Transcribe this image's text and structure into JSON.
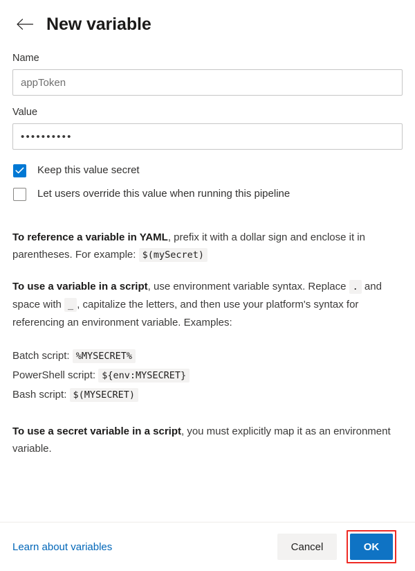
{
  "header": {
    "back_icon": "arrow-left-icon",
    "title": "New variable"
  },
  "form": {
    "name_label": "Name",
    "name_value": "appToken",
    "name_placeholder": "appToken",
    "value_label": "Value",
    "value_masked": "••••••••••",
    "value_placeholder": "",
    "checkboxes": [
      {
        "label": "Keep this value secret",
        "checked": true
      },
      {
        "label": "Let users override this value when running this pipeline",
        "checked": false
      }
    ]
  },
  "help": {
    "para1": {
      "bold": "To reference a variable in YAML",
      "text_before_code": ", prefix it with a dollar sign and enclose it in parentheses. For example: ",
      "code": "$(mySecret)"
    },
    "para2": {
      "bold": "To use a variable in a script",
      "text1": ", use environment variable syntax. Replace ",
      "code1": ".",
      "text2": " and space with ",
      "code2": "_",
      "text3": ", capitalize the letters, and then use your platform's syntax for referencing an environment variable. Examples:"
    },
    "examples": [
      {
        "label": "Batch script:",
        "code": "%MYSECRET%"
      },
      {
        "label": "PowerShell script:",
        "code": "${env:MYSECRET}"
      },
      {
        "label": "Bash script:",
        "code": "$(MYSECRET)"
      }
    ],
    "para3": {
      "bold": "To use a secret variable in a script",
      "text": ", you must explicitly map it as an environment variable."
    }
  },
  "footer": {
    "learn_link": "Learn about variables",
    "cancel_label": "Cancel",
    "ok_label": "OK"
  },
  "colors": {
    "accent": "#0078d4",
    "primary_button": "#0f73c4",
    "link": "#0066b8",
    "highlight_outline": "#ee2a24",
    "code_background": "#f3f2f1"
  }
}
